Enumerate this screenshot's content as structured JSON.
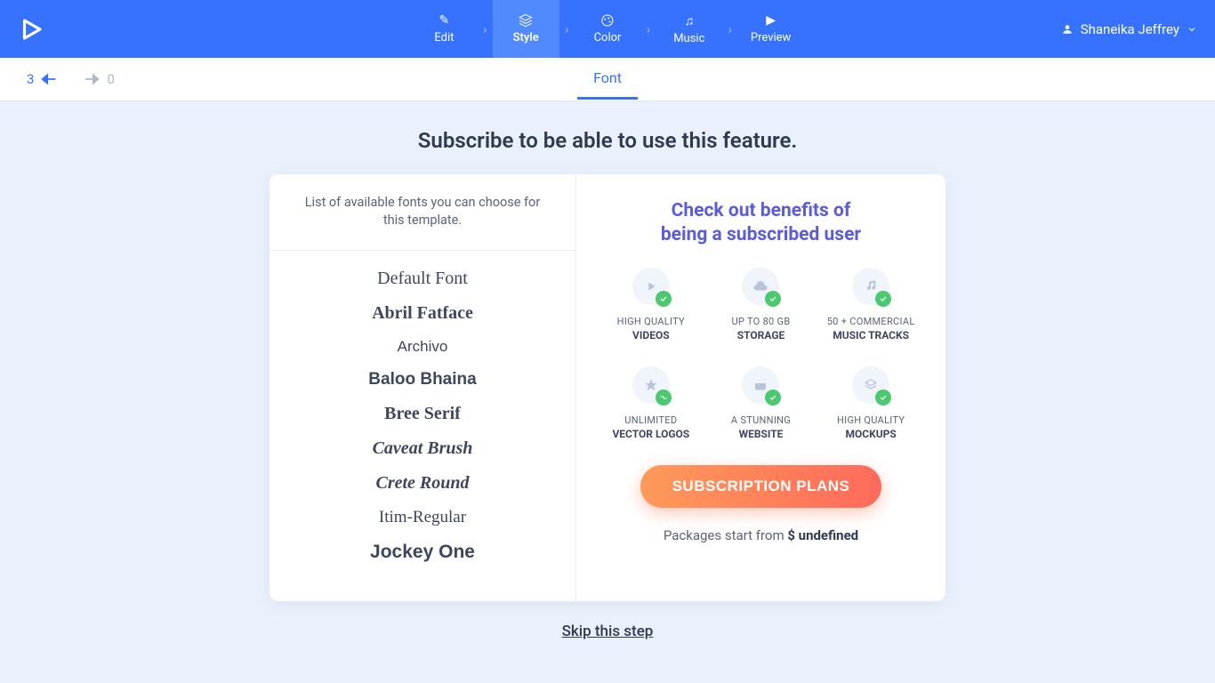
{
  "nav": {
    "steps": [
      "Edit",
      "Style",
      "Color",
      "Music",
      "Preview"
    ],
    "activeIndex": 1
  },
  "user": {
    "name": "Shaneika Jeffrey"
  },
  "undo": {
    "back": "3",
    "forward": "0"
  },
  "tab": "Font",
  "headline": "Subscribe to be able to use this feature.",
  "fontPanel": {
    "heading": "List of available fonts you can choose for this template.",
    "fonts": [
      "Default Font",
      "Abril Fatface",
      "Archivo",
      "Baloo Bhaina",
      "Bree Serif",
      "Caveat Brush",
      "Crete Round",
      "Itim-Regular",
      "Jockey One"
    ]
  },
  "sub": {
    "title1": "Check out benefits of",
    "title2": "being a subscribed user",
    "benefits": [
      {
        "line1": "HIGH QUALITY",
        "line2": "VIDEOS",
        "icon": "play-icon",
        "check": "check"
      },
      {
        "line1": "UP TO 80 GB",
        "line2": "STORAGE",
        "icon": "cloud-icon",
        "check": "check"
      },
      {
        "line1": "50 + COMMERCIAL",
        "line2": "MUSIC TRACKS",
        "icon": "music-icon",
        "check": "check"
      },
      {
        "line1": "UNLIMITED",
        "line2": "VECTOR LOGOS",
        "icon": "star-icon",
        "check": "infinity"
      },
      {
        "line1": "A STUNNING",
        "line2": "WEBSITE",
        "icon": "browser-icon",
        "check": "check"
      },
      {
        "line1": "HIGH QUALITY",
        "line2": "MOCKUPS",
        "icon": "layers-icon",
        "check": "check"
      }
    ],
    "button": "SUBSCRIPTION PLANS",
    "pkg_prefix": "Packages start from ",
    "pkg_price": "$ undefined"
  },
  "skip": "Skip this step"
}
